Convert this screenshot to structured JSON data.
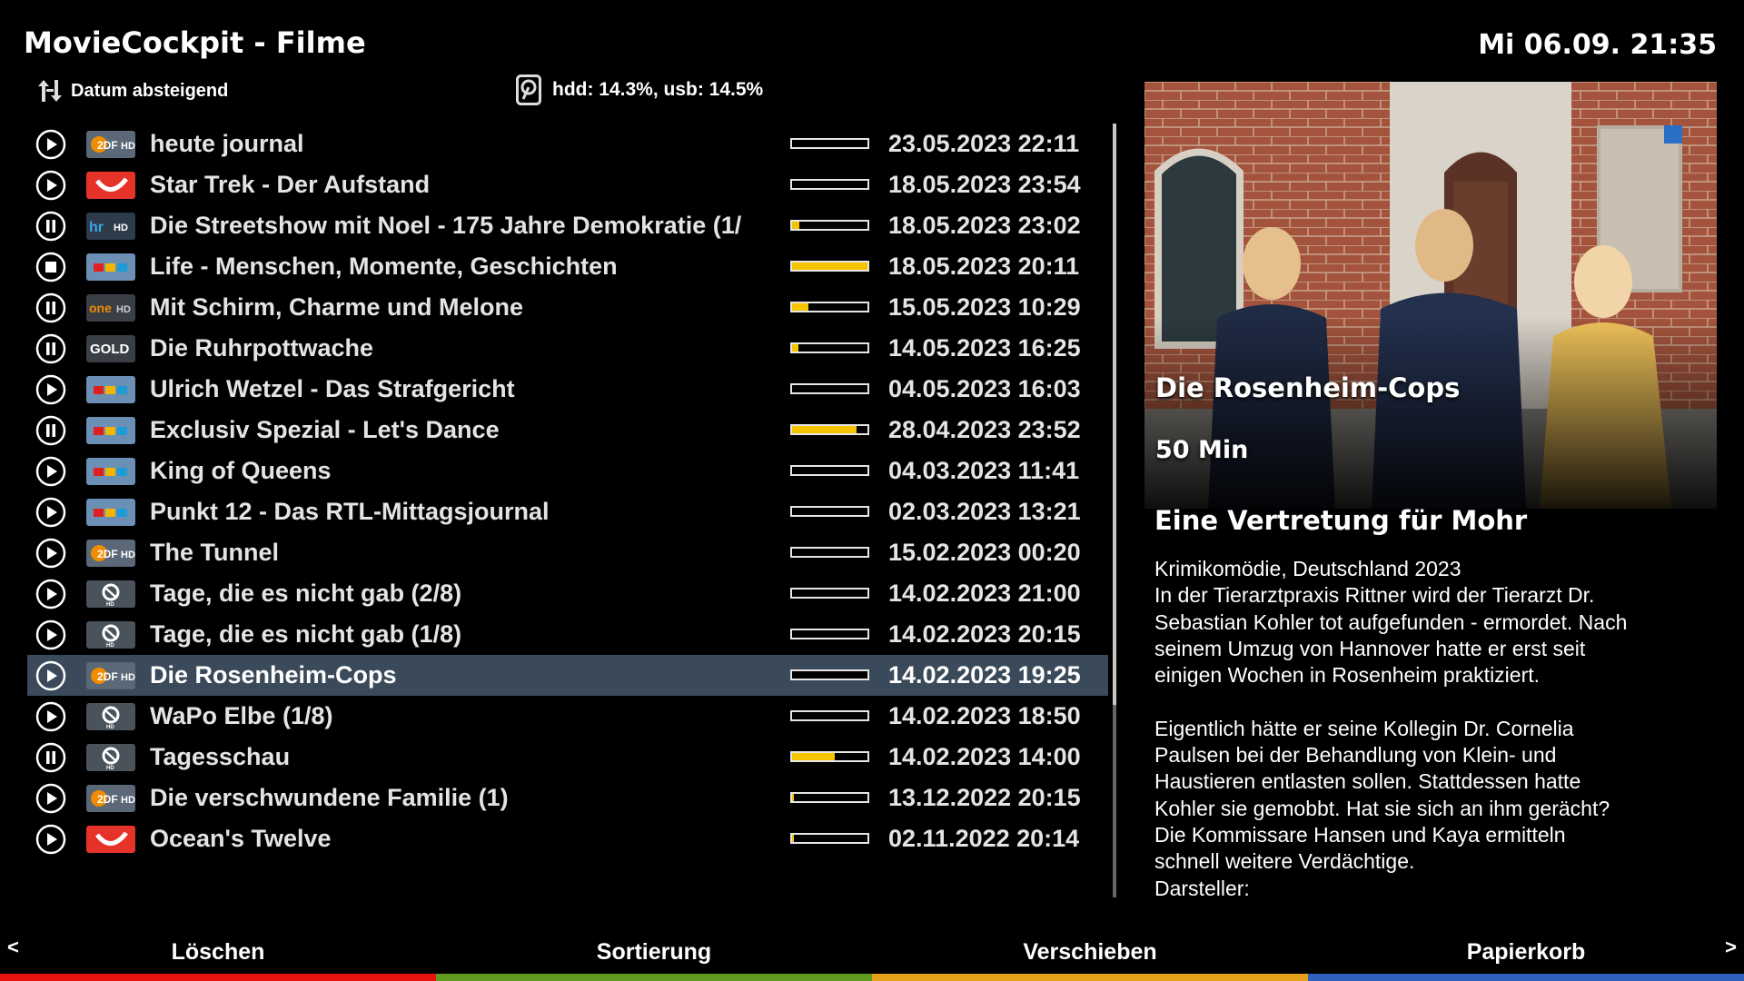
{
  "header": {
    "title": "MovieCockpit - Filme",
    "clock": "Mi 06.09. 21:35",
    "sort_label": "Datum absteigend",
    "disk_label": "hdd: 14.3%, usb: 14.5%"
  },
  "recordings": [
    {
      "status": "play",
      "channel": "ZDF HD",
      "title": "heute journal",
      "progress": 0,
      "date": "23.05.2023 22:11"
    },
    {
      "status": "play",
      "channel": "kabel eins",
      "title": "Star Trek - Der Aufstand",
      "progress": 0,
      "date": "18.05.2023 23:54"
    },
    {
      "status": "pause",
      "channel": "hr HD",
      "title": "Die Streetshow mit Noel - 175 Jahre Demokratie (1/",
      "progress": 0.1,
      "date": "18.05.2023 23:02"
    },
    {
      "status": "stop",
      "channel": "RTL",
      "title": "Life - Menschen, Momente, Geschichten",
      "progress": 1.0,
      "date": "18.05.2023 20:11"
    },
    {
      "status": "pause",
      "channel": "ONE HD",
      "title": "Mit Schirm, Charme und Melone",
      "progress": 0.22,
      "date": "15.05.2023 10:29"
    },
    {
      "status": "pause",
      "channel": "GOLD",
      "title": "Die Ruhrpottwache",
      "progress": 0.08,
      "date": "14.05.2023 16:25"
    },
    {
      "status": "play",
      "channel": "RTL",
      "title": "Ulrich Wetzel - Das Strafgericht",
      "progress": 0,
      "date": "04.05.2023 16:03"
    },
    {
      "status": "pause",
      "channel": "RTL",
      "title": "Exclusiv Spezial - Let's Dance",
      "progress": 0.85,
      "date": "28.04.2023 23:52"
    },
    {
      "status": "play",
      "channel": "RTL",
      "title": "King of Queens",
      "progress": 0,
      "date": "04.03.2023 11:41"
    },
    {
      "status": "play",
      "channel": "RTL",
      "title": "Punkt 12 - Das RTL-Mittagsjournal",
      "progress": 0,
      "date": "02.03.2023 13:21"
    },
    {
      "status": "play",
      "channel": "ZDF HD",
      "title": "The Tunnel",
      "progress": 0,
      "date": "15.02.2023 00:20"
    },
    {
      "status": "play",
      "channel": "Das Erste HD",
      "title": "Tage, die es nicht gab (2/8)",
      "progress": 0,
      "date": "14.02.2023 21:00"
    },
    {
      "status": "play",
      "channel": "Das Erste HD",
      "title": "Tage, die es nicht gab (1/8)",
      "progress": 0,
      "date": "14.02.2023 20:15"
    },
    {
      "status": "play",
      "channel": "ZDF HD",
      "title": "Die Rosenheim-Cops",
      "progress": 0,
      "date": "14.02.2023 19:25",
      "selected": true
    },
    {
      "status": "play",
      "channel": "Das Erste HD",
      "title": "WaPo Elbe (1/8)",
      "progress": 0,
      "date": "14.02.2023 18:50"
    },
    {
      "status": "pause",
      "channel": "Das Erste HD",
      "title": "Tagesschau",
      "progress": 0.57,
      "date": "14.02.2023 14:00"
    },
    {
      "status": "play",
      "channel": "ZDF HD",
      "title": "Die verschwundene Familie (1)",
      "progress": 0.03,
      "date": "13.12.2022 20:15"
    },
    {
      "status": "play",
      "channel": "kabel eins",
      "title": "Ocean's Twelve",
      "progress": 0.03,
      "date": "02.11.2022 20:14"
    }
  ],
  "details": {
    "show_title": "Die Rosenheim-Cops",
    "duration": "50 Min",
    "episode_title": "Eine Vertretung für Mohr",
    "description_lines": [
      "Krimikomödie, Deutschland 2023",
      "In der Tierarztpraxis Rittner wird der Tierarzt Dr.",
      "Sebastian Kohler tot aufgefunden - ermordet. Nach",
      "seinem Umzug von Hannover hatte er erst seit",
      "einigen Wochen in Rosenheim praktiziert.",
      "",
      "Eigentlich hätte er seine Kollegin Dr. Cornelia",
      "Paulsen bei der Behandlung von Klein- und",
      "Haustieren entlasten sollen. Stattdessen hatte",
      "Kohler sie gemobbt. Hat sie sich an ihm gerächt?",
      "Die Kommissare Hansen und Kaya ermitteln",
      "schnell weitere Verdächtige.",
      "Darsteller:"
    ]
  },
  "footer": {
    "left_arrow": "<",
    "right_arrow": ">",
    "buttons": [
      {
        "label": "Löschen",
        "color": "#e8120e"
      },
      {
        "label": "Sortierung",
        "color": "#5f9c1f"
      },
      {
        "label": "Verschieben",
        "color": "#e3a21a"
      },
      {
        "label": "Papierkorb",
        "color": "#2f5fbf"
      }
    ]
  },
  "colors": {
    "progress_fill": "#f6c300",
    "selection": "#3a4a5a"
  }
}
